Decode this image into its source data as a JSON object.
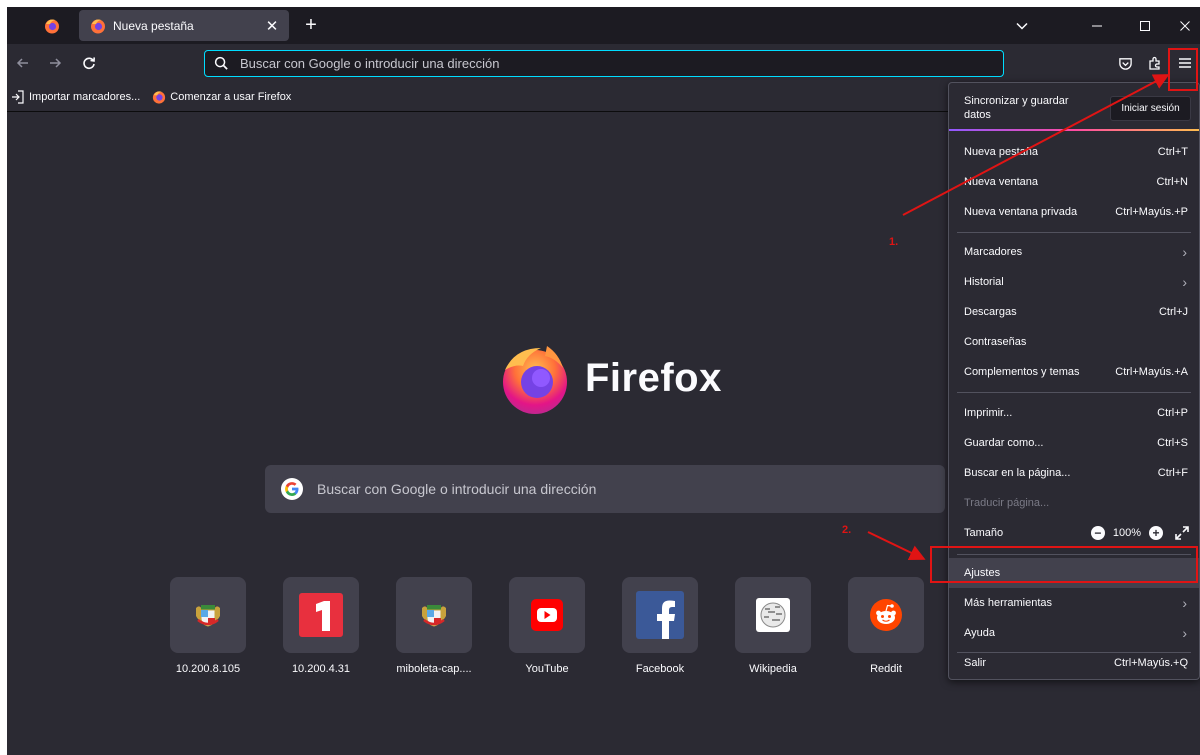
{
  "tabs": {
    "active_title": "Nueva pestaña"
  },
  "urlbar": {
    "placeholder": "Buscar con Google o introducir una dirección"
  },
  "bookmarks": [
    {
      "label": "Importar marcadores..."
    },
    {
      "label": "Comenzar a usar Firefox"
    }
  ],
  "newtab": {
    "brand": "Firefox",
    "search_placeholder": "Buscar con Google o introducir una dirección",
    "top_sites": [
      {
        "label": "10.200.8.105",
        "icon": "peru-coat-of-arms-icon"
      },
      {
        "label": "10.200.4.31",
        "icon": "number-one-icon"
      },
      {
        "label": "miboleta-cap....",
        "icon": "peru-coat-of-arms-icon"
      },
      {
        "label": "YouTube",
        "icon": "youtube-icon"
      },
      {
        "label": "Facebook",
        "icon": "facebook-icon"
      },
      {
        "label": "Wikipedia",
        "icon": "wikipedia-icon"
      },
      {
        "label": "Reddit",
        "icon": "reddit-icon"
      }
    ]
  },
  "menu": {
    "sync_text": "Sincronizar y guardar datos",
    "signin_label": "Iniciar sesión",
    "items": {
      "new_tab": {
        "label": "Nueva pestaña",
        "shortcut": "Ctrl+T"
      },
      "new_window": {
        "label": "Nueva ventana",
        "shortcut": "Ctrl+N"
      },
      "new_private": {
        "label": "Nueva ventana privada",
        "shortcut": "Ctrl+Mayús.+P"
      },
      "bookmarks": {
        "label": "Marcadores"
      },
      "history": {
        "label": "Historial"
      },
      "downloads": {
        "label": "Descargas",
        "shortcut": "Ctrl+J"
      },
      "passwords": {
        "label": "Contraseñas"
      },
      "addons": {
        "label": "Complementos y temas",
        "shortcut": "Ctrl+Mayús.+A"
      },
      "print": {
        "label": "Imprimir...",
        "shortcut": "Ctrl+P"
      },
      "save_as": {
        "label": "Guardar como...",
        "shortcut": "Ctrl+S"
      },
      "find": {
        "label": "Buscar en la página...",
        "shortcut": "Ctrl+F"
      },
      "translate": {
        "label": "Traducir página..."
      },
      "zoom": {
        "label": "Tamaño",
        "value": "100%"
      },
      "settings": {
        "label": "Ajustes"
      },
      "more_tools": {
        "label": "Más herramientas"
      },
      "help": {
        "label": "Ayuda"
      },
      "quit": {
        "label": "Salir",
        "shortcut": "Ctrl+Mayús.+Q"
      }
    }
  },
  "annotations": {
    "step1": "1.",
    "step2": "2.",
    "color": "#e01414"
  }
}
